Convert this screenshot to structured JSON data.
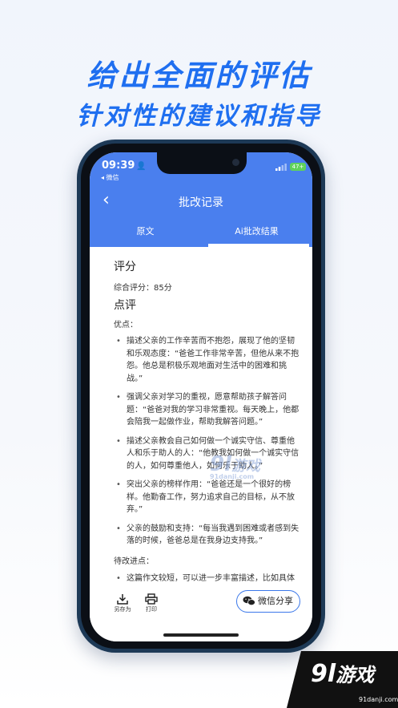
{
  "promo": {
    "headline1": "给出全面的评估",
    "headline2": "针对性的建议和指导"
  },
  "status_bar": {
    "time": "09:39",
    "back_app": "◂ 微信",
    "battery": "47+"
  },
  "nav": {
    "back_glyph": "‹",
    "title": "批改记录"
  },
  "tabs": [
    {
      "label": "原文",
      "active": false
    },
    {
      "label": "Ai批改结果",
      "active": true
    }
  ],
  "result": {
    "score_heading": "评分",
    "score_line": "综合评分：85分",
    "review_heading": "点评",
    "strengths_label": "优点：",
    "strengths": [
      "描述父亲的工作辛苦而不抱怨，展现了他的坚韧和乐观态度：“爸爸工作非常辛苦，但他从来不抱怨。他总是积极乐观地面对生活中的困难和挑战。”",
      "强调父亲对学习的重视，愿意帮助孩子解答问题：“爸爸对我的学习非常重视。每天晚上，他都会陪我一起做作业，帮助我解答问题。”",
      "描述父亲教会自己如何做一个诚实守信、尊重他人和乐于助人的人：“他教我如何做一个诚实守信的人，如何尊重他人，如何乐于助人。”",
      "突出父亲的榜样作用：“爸爸还是一个很好的榜样。他勤奋工作，努力追求自己的目标，从不放弃。”",
      "父亲的鼓励和支持：“每当我遇到困难或者感到失落的时候，爸爸总是在我身边支持我。”"
    ],
    "improve_label": "待改进点：",
    "improvements": [
      "这篇作文较短，可以进一步丰富描述，比如具体举例说明父亲的工作内容、他帮助你解"
    ]
  },
  "bottom_bar": {
    "save_label": "另存为",
    "print_label": "打印",
    "share_label": "微信分享"
  },
  "watermark": {
    "brand_logo": "9l",
    "brand_cn": "游戏",
    "site": "91danji.com"
  },
  "colors": {
    "accent": "#4a7fee",
    "headline": "#1f6ff0",
    "share_border": "#3b78ea"
  }
}
